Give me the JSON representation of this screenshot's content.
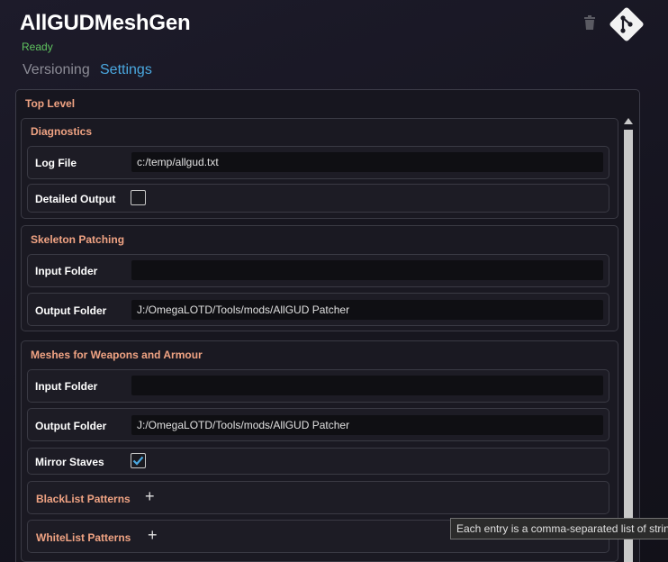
{
  "header": {
    "title": "AllGUDMeshGen",
    "status": "Ready",
    "status_color": "#5fc35f",
    "tabs": [
      {
        "label": "Versioning",
        "active": false
      },
      {
        "label": "Settings",
        "active": true
      }
    ],
    "icons": [
      "trash-icon",
      "git-icon"
    ]
  },
  "settings": {
    "top_level_label": "Top Level",
    "diagnostics": {
      "title": "Diagnostics",
      "log_file_label": "Log File",
      "log_file_value": "c:/temp/allgud.txt",
      "detailed_output_label": "Detailed Output",
      "detailed_output_checked": false
    },
    "skeleton": {
      "title": "Skeleton Patching",
      "input_folder_label": "Input Folder",
      "input_folder_value": "",
      "output_folder_label": "Output Folder",
      "output_folder_value": "J:/OmegaLOTD/Tools/mods/AllGUD Patcher"
    },
    "meshes": {
      "title": "Meshes for Weapons and Armour",
      "input_folder_label": "Input Folder",
      "input_folder_value": "",
      "output_folder_label": "Output Folder",
      "output_folder_value": "J:/OmegaLOTD/Tools/mods/AllGUD Patcher",
      "mirror_staves_label": "Mirror Staves",
      "mirror_staves_checked": true,
      "blacklist_label": "BlackList Patterns",
      "whitelist_label": "WhiteList Patterns",
      "add_symbol": "+"
    }
  },
  "tooltip": "Each entry is a comma-separated list of strin",
  "colors": {
    "accent": "#4aa8e0",
    "section_title": "#f0a383",
    "background": "#17161f"
  }
}
